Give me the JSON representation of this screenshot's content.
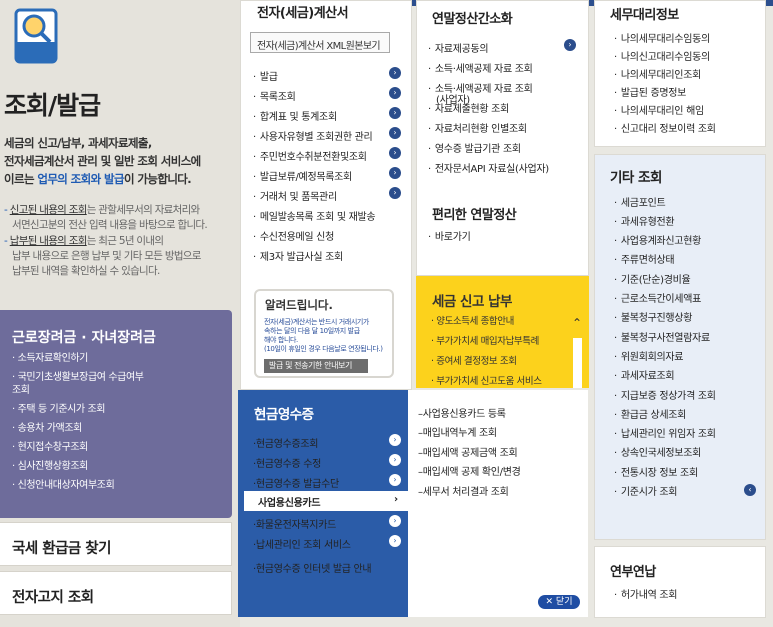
{
  "page": {
    "title": "조회/발급",
    "intro_1": "세금의 신고/납부, 과세자료제출,",
    "intro_2": "전자세금계산서 관리 및 일반 조회 서비스에",
    "intro_3a": "이르는 ",
    "intro_3b": "업무의 조회와 발급",
    "intro_3c": "이 가능합니다.",
    "note1_a": "신고된 내용의 조회",
    "note1_b": "는 관할세무서의 자료처리와",
    "note1_c": "서면신고분의 전산 입력 내용을 바탕으로 합니다.",
    "note2_a": "납부된 내용의 조회",
    "note2_b": "는 최근 5년 이내의",
    "note2_c": "납부 내용으로 은행 납부 및 기타 모든 방법으로",
    "note2_d": "납부된 내역을 확인하실 수 있습니다."
  },
  "purple": {
    "title": "근로장려금 · 자녀장려금",
    "items": [
      "소득자료확인하기",
      "국민기초생활보장급여 수급여부",
      "조회",
      "주택 등 기준시가 조회",
      "송용차 가액조회",
      "현지접수창구조회",
      "심사진행상황조회",
      "신청안내대상자여부조회"
    ]
  },
  "refund_button": "국세 환급금 찾기",
  "notice_button": "전자고지 조회",
  "col1": {
    "title": "전자(세금)계산서",
    "xml_button": "전자(세금)계산서 XML원본보기",
    "items": [
      "발급",
      "목록조회",
      "합계표 및 통계조회",
      "사용자유형별 조회권한 관리",
      "주민번호수취분전환및조회",
      "발급보류/예정목록조회",
      "거래처 및 품목관리",
      "메일발송목록 조회 및 재발송",
      "수신전용메일 신청",
      "제3자 발급사실 조회"
    ]
  },
  "notice": {
    "title": "알려드립니다.",
    "body_1": "전자(세금)계산서는 반드시 거래시기가",
    "body_2": "속하는 달의 다음 달 10일까지 발급",
    "body_3": "해야 합니다.",
    "body_4": "(10일이 휴일인 경우 다음날로 연장됩니다.)",
    "button": "발급 및 전송기한 안내보기"
  },
  "col2": {
    "title": "연말정산간소화",
    "items": [
      "자료제공동의",
      "소득·세액공제 자료 조회",
      "소득·세액공제 자료 조회",
      "(사업자)",
      "자료제출현황 조회",
      "자료처리현황 인별조회",
      "영수증 발급기관 조회",
      "전자문서API 자료실(사업자)"
    ],
    "title2": "편리한 연말정산",
    "items2": [
      "바로가기"
    ]
  },
  "yellow": {
    "title": "세금 신고 납부",
    "items": [
      "양도소득세 종합안내",
      "부가가치세 매입자납부특례",
      "증여세 결정정보 조회",
      "부가가치세 신고도움 서비스"
    ]
  },
  "blue": {
    "title": "현금영수증",
    "items": [
      "현금영수증조회",
      "현금영수증 수정",
      "현금영수증 발급수단",
      "사업용신용카드",
      "화물운전자복지카드",
      "납세관리인 조회 서비스",
      "현금영수증 인터넷 발급 안내"
    ],
    "sub_items": [
      "사업용신용카드 등록",
      "매입내역누계 조회",
      "매입세액 공제금액 조회",
      "매입세액 공제 확인/변경",
      "세무서 처리결과 조회"
    ],
    "close_button": "닫기"
  },
  "col3": {
    "title": "세무대리정보",
    "items": [
      "나의세무대리수임동의",
      "나의신고대리수임동의",
      "나의세무대리인조회",
      "발급된 증명정보",
      "나의세무대리인 해임",
      "신고대리 정보이력 조회"
    ]
  },
  "etc": {
    "title": "기타 조회",
    "items": [
      "세금포인트",
      "과세유형전환",
      "사업용계좌신고현황",
      "주류면허상태",
      "기준(단순)경비율",
      "근로소득간이세액표",
      "불복청구진행상황",
      "불복청구사전열람자료",
      "위원회회의자료",
      "과세자료조회",
      "지급보증 정상가격 조회",
      "환급금 상세조회",
      "납세관리인 위임자 조회",
      "상속인국세정보조회",
      "전통시장 정보 조회",
      "기준시가 조회"
    ]
  },
  "etc2": {
    "title": "연부연납",
    "items": [
      "허가내역 조회"
    ]
  }
}
